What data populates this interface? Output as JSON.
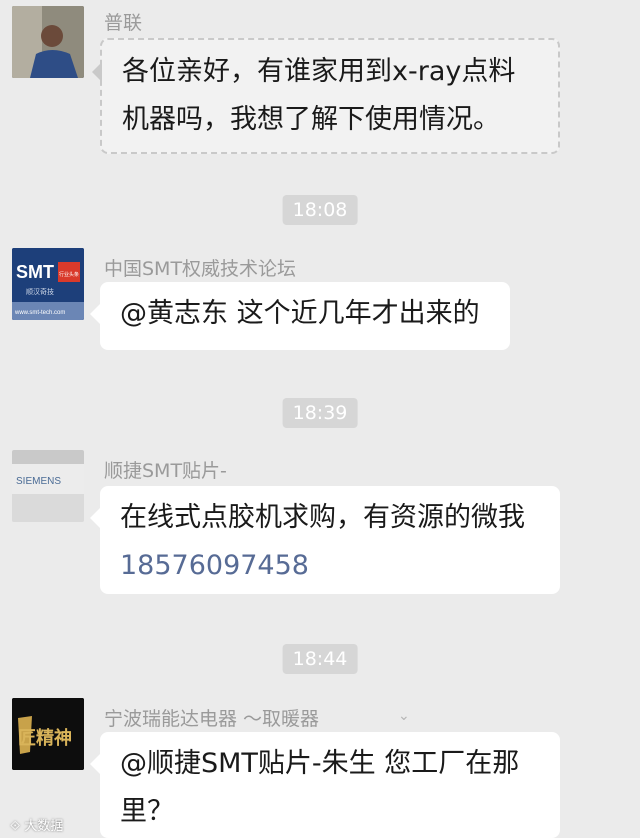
{
  "messages": [
    {
      "sender": "普联",
      "text": "各位亲好，有谁家用到x-ray点料机器吗，我想了解下使用情况。",
      "avatar_icon": "person-photo-icon"
    },
    {
      "sender": "中国SMT权威技术论坛",
      "text": "@黄志东 这个近几年才出来的",
      "avatar_icon": "smt-logo-icon",
      "avatar_texts": {
        "logo": "SMT",
        "badge": "行业头条",
        "sub": "顺汉奇技",
        "url": "www.smt-tech.com"
      }
    },
    {
      "sender": "顺捷SMT贴片-",
      "text": "在线式点胶机求购，有资源的微我",
      "phone": "18576097458",
      "avatar_icon": "siemens-machine-icon",
      "avatar_texts": {
        "brand": "SIEMENS"
      }
    },
    {
      "sender": "宁波瑞能达电器 ～取暖器",
      "text": "@顺捷SMT贴片-朱生 您工厂在那里？",
      "avatar_icon": "craftsman-spirit-icon",
      "avatar_texts": {
        "calligraphy": "匠精神"
      }
    }
  ],
  "timestamps": [
    "18:08",
    "18:39",
    "18:44"
  ],
  "watermark": "大数据"
}
